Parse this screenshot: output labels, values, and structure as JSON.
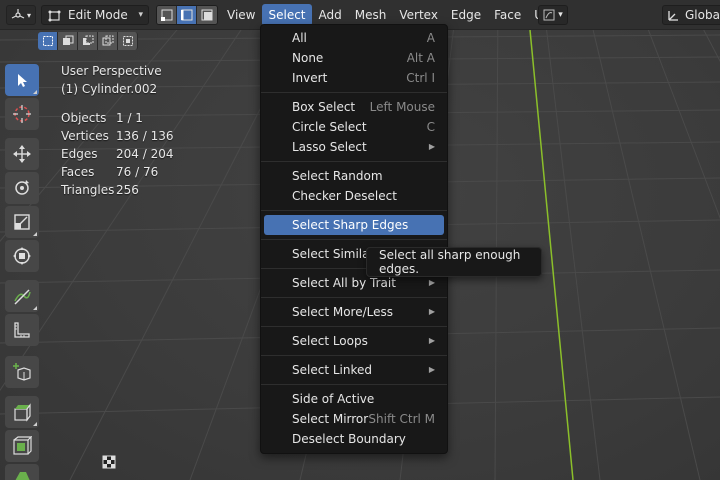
{
  "header": {
    "mode": "Edit Mode",
    "menus": [
      "View",
      "Select",
      "Add",
      "Mesh",
      "Vertex",
      "Edge",
      "Face",
      "UV"
    ],
    "active_menu": "Select",
    "orientation": "Global"
  },
  "overlay": {
    "view": "User Perspective",
    "object": "(1) Cylinder.002",
    "stats": [
      {
        "label": "Objects",
        "value": "1 / 1"
      },
      {
        "label": "Vertices",
        "value": "136 / 136"
      },
      {
        "label": "Edges",
        "value": "204 / 204"
      },
      {
        "label": "Faces",
        "value": "76 / 76"
      },
      {
        "label": "Triangles",
        "value": "256"
      }
    ]
  },
  "select_menu": {
    "items": {
      "all": {
        "label": "All",
        "shortcut": "A"
      },
      "none": {
        "label": "None",
        "shortcut": "Alt A"
      },
      "invert": {
        "label": "Invert",
        "shortcut": "Ctrl I"
      },
      "box_select": {
        "label": "Box Select",
        "shortcut": "Left Mouse"
      },
      "circle_select": {
        "label": "Circle Select",
        "shortcut": "C"
      },
      "lasso_select": {
        "label": "Lasso Select"
      },
      "select_random": {
        "label": "Select Random"
      },
      "checker_deselect": {
        "label": "Checker Deselect"
      },
      "select_sharp_edges": {
        "label": "Select Sharp Edges"
      },
      "select_similar": {
        "label": "Select Similar"
      },
      "select_all_by_trait": {
        "label": "Select All by Trait"
      },
      "select_more_less": {
        "label": "Select More/Less"
      },
      "select_loops": {
        "label": "Select Loops"
      },
      "select_linked": {
        "label": "Select Linked"
      },
      "side_of_active": {
        "label": "Side of Active"
      },
      "select_mirror": {
        "label": "Select Mirror",
        "shortcut": "Shift Ctrl M"
      },
      "deselect_boundary": {
        "label": "Deselect Boundary"
      }
    }
  },
  "tooltip": {
    "text": "Select all sharp enough edges."
  },
  "colors": {
    "accent": "#4772b3",
    "menu_bg": "#181818",
    "header_bg": "#303030",
    "y_axis": "#8bbf2a"
  }
}
